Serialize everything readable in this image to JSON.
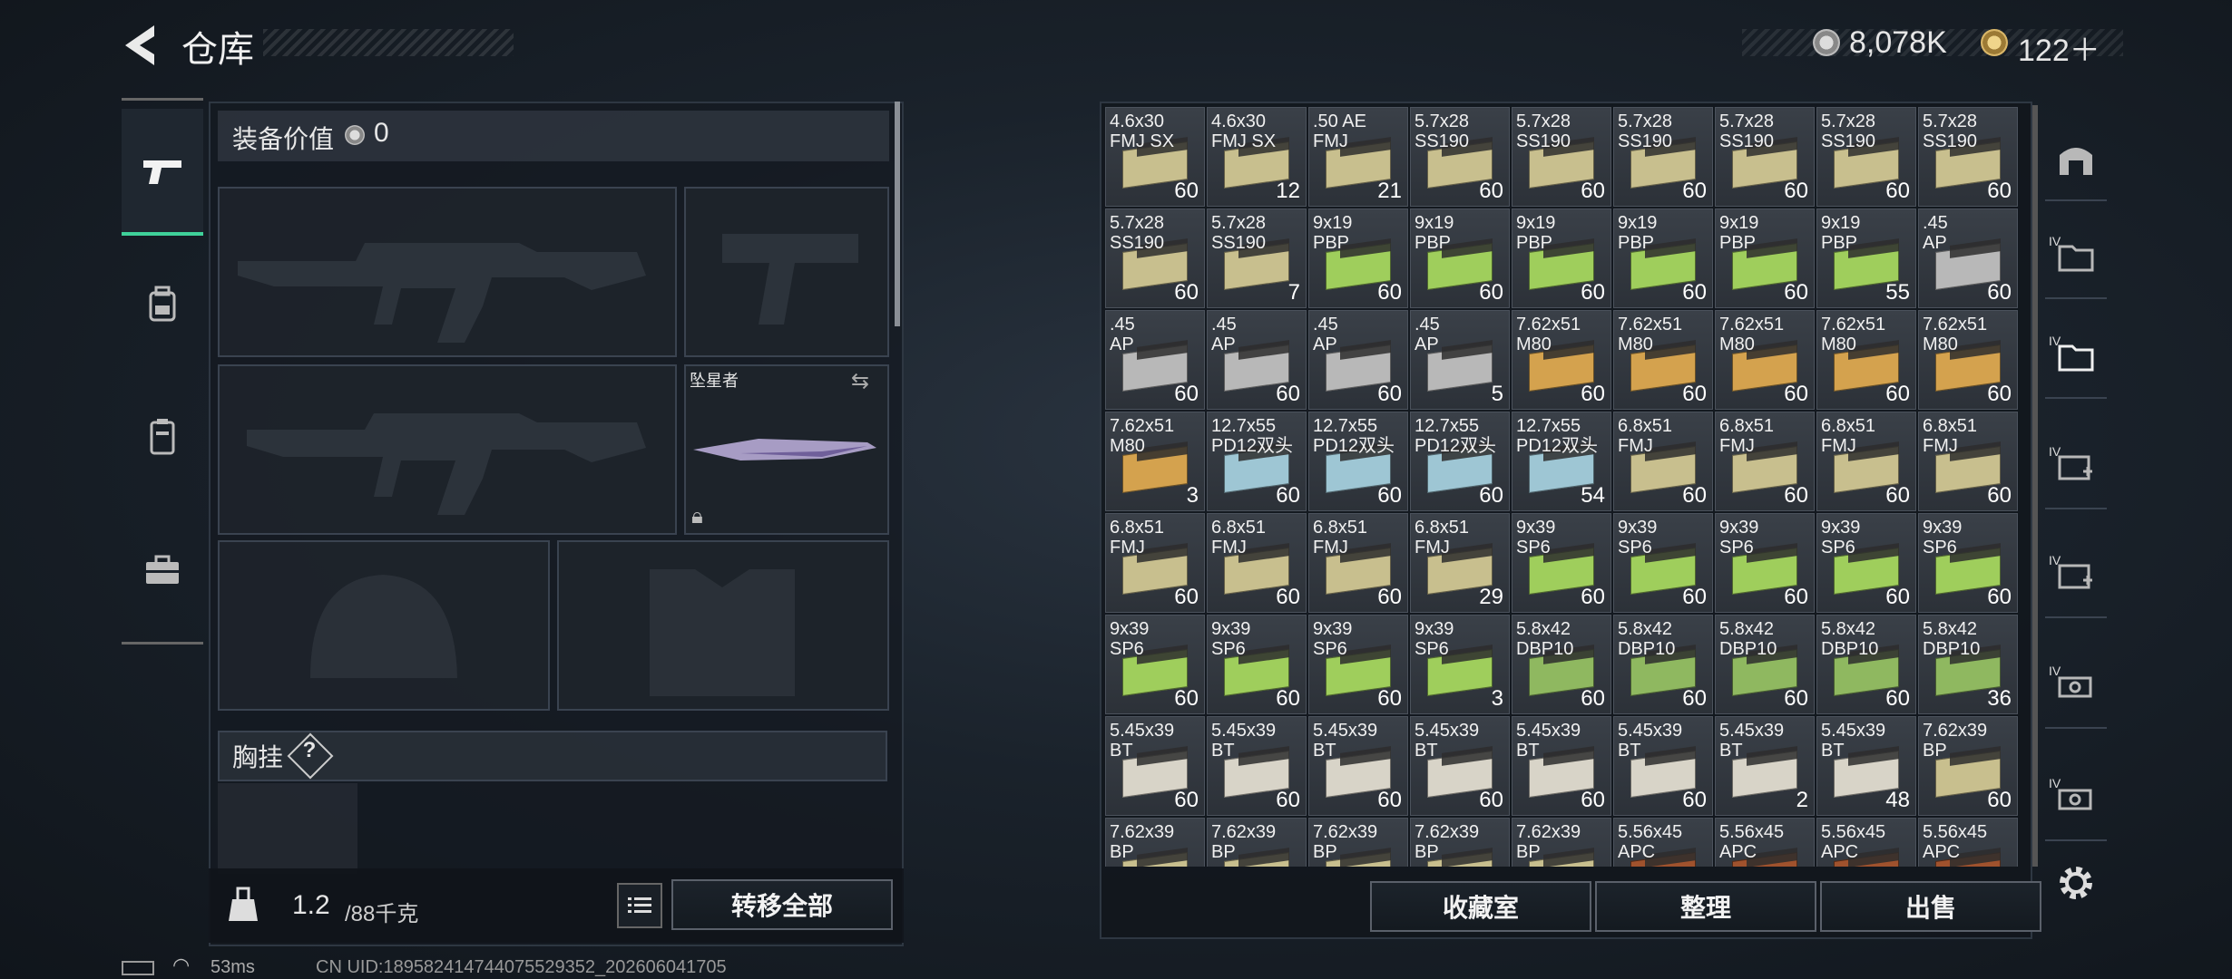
{
  "header": {
    "title": "仓库",
    "currency1": "8,078K",
    "currency2": "122＋"
  },
  "left_panel": {
    "equip_value_label": "装备价值",
    "equip_value": "0",
    "melee_name": "坠星者",
    "chest_label": "胸挂",
    "chest_help": "?",
    "weight_current": "1.2",
    "weight_max": "/88千克",
    "transfer_all": "转移全部"
  },
  "stash": {
    "items": [
      {
        "name": "4.6x30\nFMJ SX",
        "count": "60",
        "color": "#c8bf8e"
      },
      {
        "name": "4.6x30\nFMJ SX",
        "count": "12",
        "color": "#c8bf8e"
      },
      {
        "name": ".50 AE\nFMJ",
        "count": "21",
        "color": "#c8bf8e"
      },
      {
        "name": "5.7x28\nSS190",
        "count": "60",
        "color": "#c8bf8e"
      },
      {
        "name": "5.7x28\nSS190",
        "count": "60",
        "color": "#c8bf8e"
      },
      {
        "name": "5.7x28\nSS190",
        "count": "60",
        "color": "#c8bf8e"
      },
      {
        "name": "5.7x28\nSS190",
        "count": "60",
        "color": "#c8bf8e"
      },
      {
        "name": "5.7x28\nSS190",
        "count": "60",
        "color": "#c8bf8e"
      },
      {
        "name": "5.7x28\nSS190",
        "count": "60",
        "color": "#c8bf8e"
      },
      {
        "name": "5.7x28\nSS190",
        "count": "60",
        "color": "#c8bf8e"
      },
      {
        "name": "5.7x28\nSS190",
        "count": "7",
        "color": "#c8bf8e"
      },
      {
        "name": "9x19\nPBP",
        "count": "60",
        "color": "#9fce5c"
      },
      {
        "name": "9x19\nPBP",
        "count": "60",
        "color": "#9fce5c"
      },
      {
        "name": "9x19\nPBP",
        "count": "60",
        "color": "#9fce5c"
      },
      {
        "name": "9x19\nPBP",
        "count": "60",
        "color": "#9fce5c"
      },
      {
        "name": "9x19\nPBP",
        "count": "60",
        "color": "#9fce5c"
      },
      {
        "name": "9x19\nPBP",
        "count": "55",
        "color": "#9fce5c"
      },
      {
        "name": ".45\nAP",
        "count": "60",
        "color": "#b8b8b8"
      },
      {
        "name": ".45\nAP",
        "count": "60",
        "color": "#b8b8b8"
      },
      {
        "name": ".45\nAP",
        "count": "60",
        "color": "#b8b8b8"
      },
      {
        "name": ".45\nAP",
        "count": "60",
        "color": "#b8b8b8"
      },
      {
        "name": ".45\nAP",
        "count": "5",
        "color": "#b8b8b8"
      },
      {
        "name": "7.62x51\nM80",
        "count": "60",
        "color": "#d4a24e"
      },
      {
        "name": "7.62x51\nM80",
        "count": "60",
        "color": "#d4a24e"
      },
      {
        "name": "7.62x51\nM80",
        "count": "60",
        "color": "#d4a24e"
      },
      {
        "name": "7.62x51\nM80",
        "count": "60",
        "color": "#d4a24e"
      },
      {
        "name": "7.62x51\nM80",
        "count": "60",
        "color": "#d4a24e"
      },
      {
        "name": "7.62x51\nM80",
        "count": "3",
        "color": "#d4a24e"
      },
      {
        "name": "12.7x55\nPD12双头",
        "count": "60",
        "color": "#9ec6d4"
      },
      {
        "name": "12.7x55\nPD12双头",
        "count": "60",
        "color": "#9ec6d4"
      },
      {
        "name": "12.7x55\nPD12双头",
        "count": "60",
        "color": "#9ec6d4"
      },
      {
        "name": "12.7x55\nPD12双头",
        "count": "54",
        "color": "#9ec6d4"
      },
      {
        "name": "6.8x51\nFMJ",
        "count": "60",
        "color": "#c8bf8e"
      },
      {
        "name": "6.8x51\nFMJ",
        "count": "60",
        "color": "#c8bf8e"
      },
      {
        "name": "6.8x51\nFMJ",
        "count": "60",
        "color": "#c8bf8e"
      },
      {
        "name": "6.8x51\nFMJ",
        "count": "60",
        "color": "#c8bf8e"
      },
      {
        "name": "6.8x51\nFMJ",
        "count": "60",
        "color": "#c8bf8e"
      },
      {
        "name": "6.8x51\nFMJ",
        "count": "60",
        "color": "#c8bf8e"
      },
      {
        "name": "6.8x51\nFMJ",
        "count": "60",
        "color": "#c8bf8e"
      },
      {
        "name": "6.8x51\nFMJ",
        "count": "29",
        "color": "#c8bf8e"
      },
      {
        "name": "9x39\nSP6",
        "count": "60",
        "color": "#9fce5c"
      },
      {
        "name": "9x39\nSP6",
        "count": "60",
        "color": "#9fce5c"
      },
      {
        "name": "9x39\nSP6",
        "count": "60",
        "color": "#9fce5c"
      },
      {
        "name": "9x39\nSP6",
        "count": "60",
        "color": "#9fce5c"
      },
      {
        "name": "9x39\nSP6",
        "count": "60",
        "color": "#9fce5c"
      },
      {
        "name": "9x39\nSP6",
        "count": "60",
        "color": "#9fce5c"
      },
      {
        "name": "9x39\nSP6",
        "count": "60",
        "color": "#9fce5c"
      },
      {
        "name": "9x39\nSP6",
        "count": "60",
        "color": "#9fce5c"
      },
      {
        "name": "9x39\nSP6",
        "count": "3",
        "color": "#9fce5c"
      },
      {
        "name": "5.8x42\nDBP10",
        "count": "60",
        "color": "#8fb860"
      },
      {
        "name": "5.8x42\nDBP10",
        "count": "60",
        "color": "#8fb860"
      },
      {
        "name": "5.8x42\nDBP10",
        "count": "60",
        "color": "#8fb860"
      },
      {
        "name": "5.8x42\nDBP10",
        "count": "60",
        "color": "#8fb860"
      },
      {
        "name": "5.8x42\nDBP10",
        "count": "36",
        "color": "#8fb860"
      },
      {
        "name": "5.45x39\nBT",
        "count": "60",
        "color": "#d8d4c8"
      },
      {
        "name": "5.45x39\nBT",
        "count": "60",
        "color": "#d8d4c8"
      },
      {
        "name": "5.45x39\nBT",
        "count": "60",
        "color": "#d8d4c8"
      },
      {
        "name": "5.45x39\nBT",
        "count": "60",
        "color": "#d8d4c8"
      },
      {
        "name": "5.45x39\nBT",
        "count": "60",
        "color": "#d8d4c8"
      },
      {
        "name": "5.45x39\nBT",
        "count": "60",
        "color": "#d8d4c8"
      },
      {
        "name": "5.45x39\nBT",
        "count": "2",
        "color": "#d8d4c8"
      },
      {
        "name": "5.45x39\nBT",
        "count": "48",
        "color": "#d8d4c8"
      },
      {
        "name": "7.62x39\nBP",
        "count": "60",
        "color": "#c8bf8e"
      },
      {
        "name": "7.62x39\nBP",
        "count": "",
        "color": "#c8bf8e"
      },
      {
        "name": "7.62x39\nBP",
        "count": "",
        "color": "#c8bf8e"
      },
      {
        "name": "7.62x39\nBP",
        "count": "",
        "color": "#c8bf8e"
      },
      {
        "name": "7.62x39\nBP",
        "count": "",
        "color": "#c8bf8e"
      },
      {
        "name": "7.62x39\nBP",
        "count": "",
        "color": "#c8bf8e"
      },
      {
        "name": "5.56x45\nAPC",
        "count": "",
        "color": "#a0522d"
      },
      {
        "name": "5.56x45\nAPC",
        "count": "",
        "color": "#a0522d"
      },
      {
        "name": "5.56x45\nAPC",
        "count": "",
        "color": "#a0522d"
      },
      {
        "name": "5.56x45\nAPC",
        "count": "",
        "color": "#a0522d"
      }
    ],
    "buttons": {
      "vault": "收藏室",
      "sort": "整理",
      "sell": "出售"
    }
  },
  "footer": {
    "ping": "53ms",
    "uid": "CN UID:18958241474407552935​2_202606041705"
  }
}
